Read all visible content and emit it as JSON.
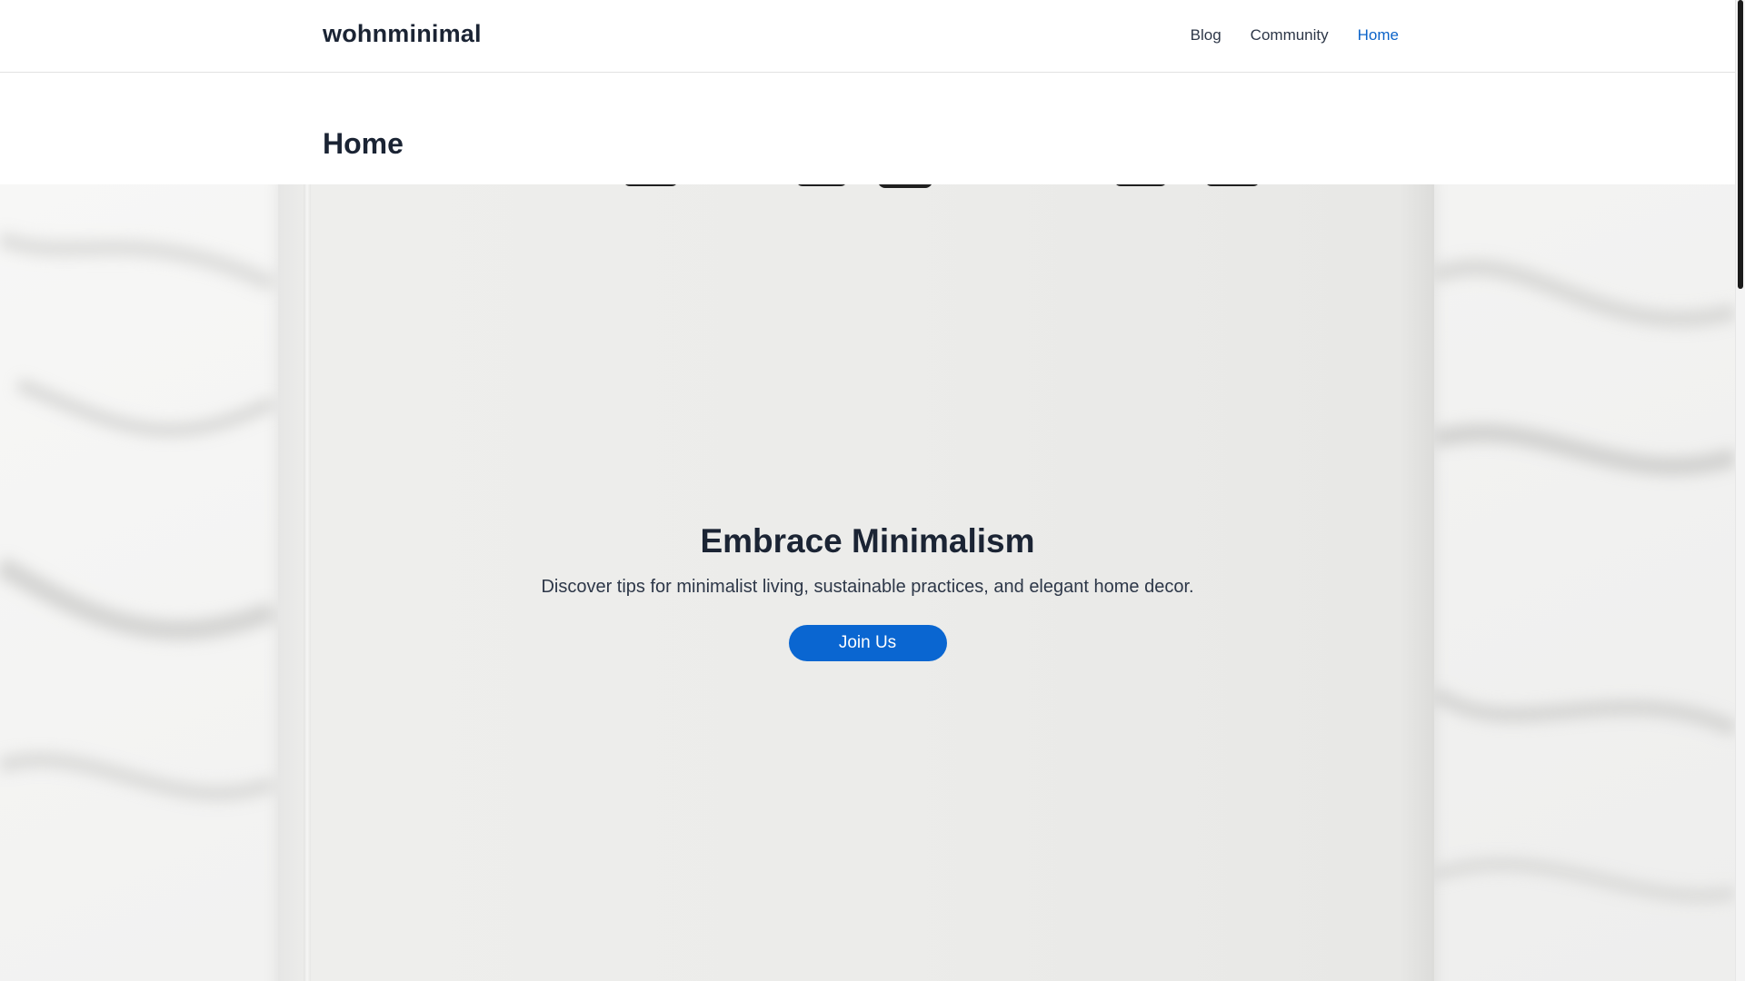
{
  "header": {
    "brand": "wohnminimal",
    "nav": [
      {
        "label": "Blog",
        "active": false
      },
      {
        "label": "Community",
        "active": false
      },
      {
        "label": "Home",
        "active": true
      }
    ]
  },
  "page": {
    "title": "Home"
  },
  "hero": {
    "title": "Embrace Minimalism",
    "subtitle": "Discover tips for minimalist living, sustainable practices, and elegant home decor.",
    "cta_label": "Join Us",
    "background_image": "white-book-on-bedsheet"
  },
  "colors": {
    "accent": "#0a66d1",
    "heading": "#1b2434",
    "text": "#2d3748"
  }
}
